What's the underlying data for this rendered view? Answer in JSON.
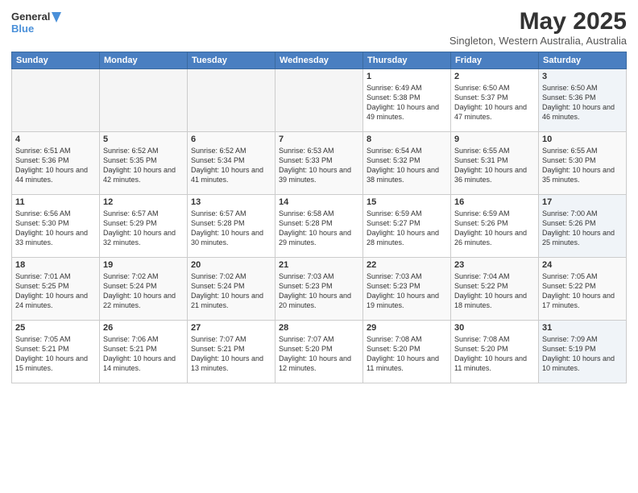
{
  "logo": {
    "line1": "General",
    "line2": "Blue"
  },
  "title": "May 2025",
  "subtitle": "Singleton, Western Australia, Australia",
  "days_of_week": [
    "Sunday",
    "Monday",
    "Tuesday",
    "Wednesday",
    "Thursday",
    "Friday",
    "Saturday"
  ],
  "weeks": [
    [
      {
        "day": "",
        "empty": true
      },
      {
        "day": "",
        "empty": true
      },
      {
        "day": "",
        "empty": true
      },
      {
        "day": "",
        "empty": true
      },
      {
        "day": "1",
        "sunrise": "6:49 AM",
        "sunset": "5:38 PM",
        "daylight": "10 hours and 49 minutes."
      },
      {
        "day": "2",
        "sunrise": "6:50 AM",
        "sunset": "5:37 PM",
        "daylight": "10 hours and 47 minutes."
      },
      {
        "day": "3",
        "sunrise": "6:50 AM",
        "sunset": "5:36 PM",
        "daylight": "10 hours and 46 minutes.",
        "saturday": true
      }
    ],
    [
      {
        "day": "4",
        "sunrise": "6:51 AM",
        "sunset": "5:36 PM",
        "daylight": "10 hours and 44 minutes."
      },
      {
        "day": "5",
        "sunrise": "6:52 AM",
        "sunset": "5:35 PM",
        "daylight": "10 hours and 42 minutes."
      },
      {
        "day": "6",
        "sunrise": "6:52 AM",
        "sunset": "5:34 PM",
        "daylight": "10 hours and 41 minutes."
      },
      {
        "day": "7",
        "sunrise": "6:53 AM",
        "sunset": "5:33 PM",
        "daylight": "10 hours and 39 minutes."
      },
      {
        "day": "8",
        "sunrise": "6:54 AM",
        "sunset": "5:32 PM",
        "daylight": "10 hours and 38 minutes."
      },
      {
        "day": "9",
        "sunrise": "6:55 AM",
        "sunset": "5:31 PM",
        "daylight": "10 hours and 36 minutes."
      },
      {
        "day": "10",
        "sunrise": "6:55 AM",
        "sunset": "5:30 PM",
        "daylight": "10 hours and 35 minutes.",
        "saturday": true
      }
    ],
    [
      {
        "day": "11",
        "sunrise": "6:56 AM",
        "sunset": "5:30 PM",
        "daylight": "10 hours and 33 minutes."
      },
      {
        "day": "12",
        "sunrise": "6:57 AM",
        "sunset": "5:29 PM",
        "daylight": "10 hours and 32 minutes."
      },
      {
        "day": "13",
        "sunrise": "6:57 AM",
        "sunset": "5:28 PM",
        "daylight": "10 hours and 30 minutes."
      },
      {
        "day": "14",
        "sunrise": "6:58 AM",
        "sunset": "5:28 PM",
        "daylight": "10 hours and 29 minutes."
      },
      {
        "day": "15",
        "sunrise": "6:59 AM",
        "sunset": "5:27 PM",
        "daylight": "10 hours and 28 minutes."
      },
      {
        "day": "16",
        "sunrise": "6:59 AM",
        "sunset": "5:26 PM",
        "daylight": "10 hours and 26 minutes."
      },
      {
        "day": "17",
        "sunrise": "7:00 AM",
        "sunset": "5:26 PM",
        "daylight": "10 hours and 25 minutes.",
        "saturday": true
      }
    ],
    [
      {
        "day": "18",
        "sunrise": "7:01 AM",
        "sunset": "5:25 PM",
        "daylight": "10 hours and 24 minutes."
      },
      {
        "day": "19",
        "sunrise": "7:02 AM",
        "sunset": "5:24 PM",
        "daylight": "10 hours and 22 minutes."
      },
      {
        "day": "20",
        "sunrise": "7:02 AM",
        "sunset": "5:24 PM",
        "daylight": "10 hours and 21 minutes."
      },
      {
        "day": "21",
        "sunrise": "7:03 AM",
        "sunset": "5:23 PM",
        "daylight": "10 hours and 20 minutes."
      },
      {
        "day": "22",
        "sunrise": "7:03 AM",
        "sunset": "5:23 PM",
        "daylight": "10 hours and 19 minutes."
      },
      {
        "day": "23",
        "sunrise": "7:04 AM",
        "sunset": "5:22 PM",
        "daylight": "10 hours and 18 minutes."
      },
      {
        "day": "24",
        "sunrise": "7:05 AM",
        "sunset": "5:22 PM",
        "daylight": "10 hours and 17 minutes.",
        "saturday": true
      }
    ],
    [
      {
        "day": "25",
        "sunrise": "7:05 AM",
        "sunset": "5:21 PM",
        "daylight": "10 hours and 15 minutes."
      },
      {
        "day": "26",
        "sunrise": "7:06 AM",
        "sunset": "5:21 PM",
        "daylight": "10 hours and 14 minutes."
      },
      {
        "day": "27",
        "sunrise": "7:07 AM",
        "sunset": "5:21 PM",
        "daylight": "10 hours and 13 minutes."
      },
      {
        "day": "28",
        "sunrise": "7:07 AM",
        "sunset": "5:20 PM",
        "daylight": "10 hours and 12 minutes."
      },
      {
        "day": "29",
        "sunrise": "7:08 AM",
        "sunset": "5:20 PM",
        "daylight": "10 hours and 11 minutes."
      },
      {
        "day": "30",
        "sunrise": "7:08 AM",
        "sunset": "5:20 PM",
        "daylight": "10 hours and 11 minutes."
      },
      {
        "day": "31",
        "sunrise": "7:09 AM",
        "sunset": "5:19 PM",
        "daylight": "10 hours and 10 minutes.",
        "saturday": true
      }
    ]
  ]
}
